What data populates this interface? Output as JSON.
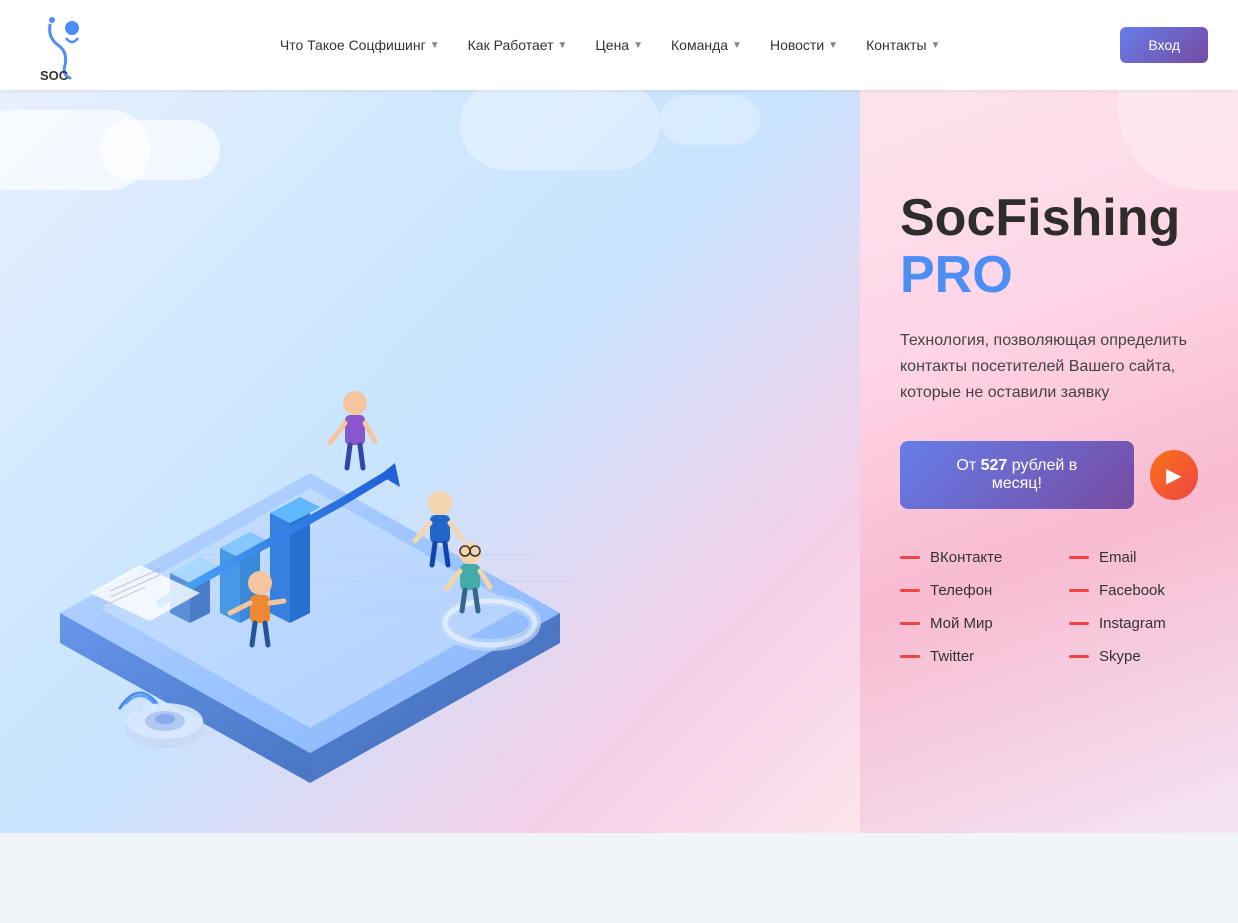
{
  "header": {
    "logo_alt": "SocFishing",
    "nav_items": [
      {
        "label": "Что Такое Соцфишинг",
        "has_dropdown": true
      },
      {
        "label": "Как Работает",
        "has_dropdown": true
      },
      {
        "label": "Цена",
        "has_dropdown": true
      },
      {
        "label": "Команда",
        "has_dropdown": true
      },
      {
        "label": "Новости",
        "has_dropdown": true
      },
      {
        "label": "Контакты",
        "has_dropdown": true
      }
    ],
    "login_label": "Вход"
  },
  "hero": {
    "title_part1": "SocFish",
    "title_part2": "ing ",
    "title_pro": "PRO",
    "subtitle": "Технология, позволяющая определить контакты посетителей Вашего сайта, которые не оставили заявку",
    "cta_label_prefix": "От ",
    "cta_price": "527",
    "cta_label_suffix": " рублей в месяц!",
    "play_icon": "▶"
  },
  "services": {
    "col1": [
      {
        "label": "ВКонтакте"
      },
      {
        "label": "Телефон"
      },
      {
        "label": "Мой Мир"
      },
      {
        "label": "Twitter"
      }
    ],
    "col2": [
      {
        "label": "Email"
      },
      {
        "label": "Facebook"
      },
      {
        "label": "Instagram"
      },
      {
        "label": "Skype"
      }
    ]
  }
}
